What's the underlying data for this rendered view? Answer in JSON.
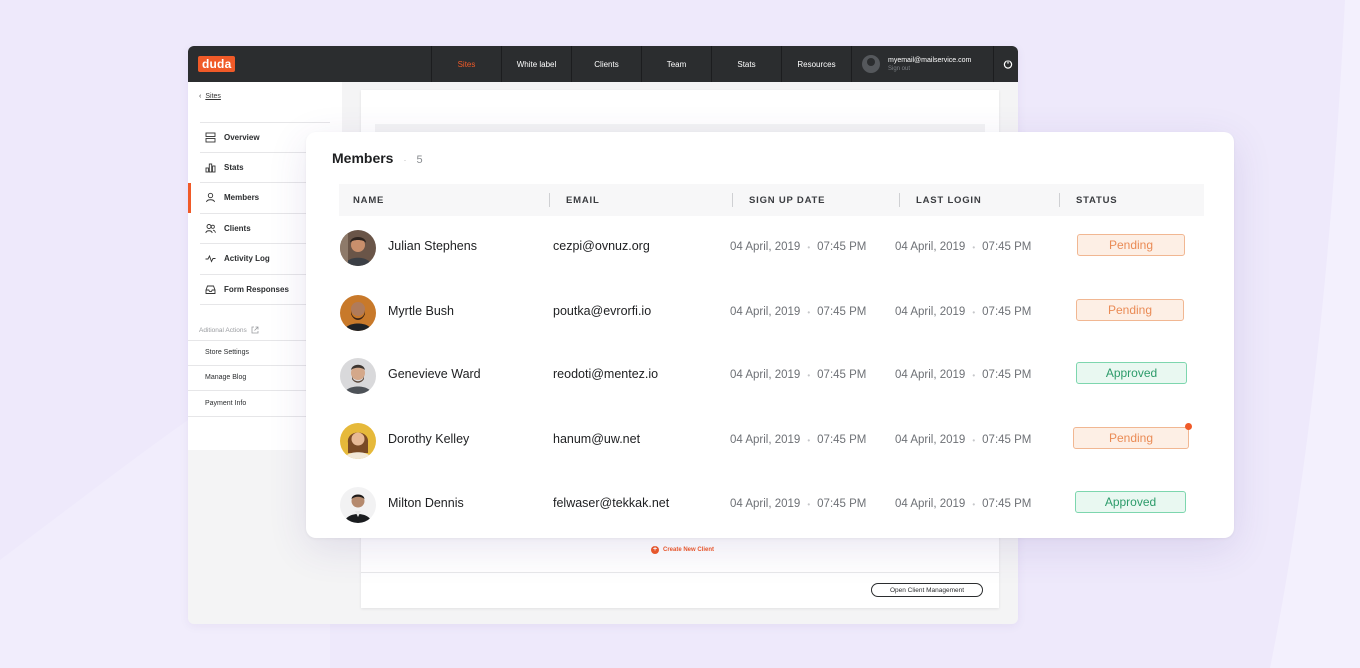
{
  "app": {
    "logo": "duda",
    "nav": [
      "Sites",
      "White label",
      "Clients",
      "Team",
      "Stats",
      "Resources"
    ],
    "active_nav": "Sites",
    "user": {
      "email": "myemail@mailservice.com",
      "signout": "Sign out"
    }
  },
  "sidebar": {
    "back_label": "Sites",
    "items": [
      {
        "label": "Overview",
        "icon": "overview-icon"
      },
      {
        "label": "Stats",
        "icon": "bar-chart-icon"
      },
      {
        "label": "Members",
        "icon": "user-icon",
        "active": true
      },
      {
        "label": "Clients",
        "icon": "users-icon"
      },
      {
        "label": "Activity Log",
        "icon": "activity-icon"
      },
      {
        "label": "Form Responses",
        "icon": "inbox-icon"
      }
    ],
    "section_label": "Aditional Actions",
    "sub_items": [
      "Store Settings",
      "Manage Blog",
      "Payment Info"
    ]
  },
  "content": {
    "create_label": "Create New Client",
    "open_button": "Open Client Management"
  },
  "members": {
    "title": "Members",
    "count": "5",
    "columns": [
      "NAME",
      "EMAIL",
      "SIGN UP DATE",
      "LAST LOGIN",
      "STATUS"
    ],
    "rows": [
      {
        "name": "Julian Stephens",
        "email": "cezpi@ovnuz.org",
        "signup_date": "04 April, 2019",
        "signup_time": "07:45 PM",
        "login_date": "04 April, 2019",
        "login_time": "07:45 PM",
        "status": "Pending"
      },
      {
        "name": "Myrtle Bush",
        "email": "poutka@evrorfi.io",
        "signup_date": "04 April, 2019",
        "signup_time": "07:45 PM",
        "login_date": "04 April, 2019",
        "login_time": "07:45 PM",
        "status": "Pending"
      },
      {
        "name": "Genevieve Ward",
        "email": "reodoti@mentez.io",
        "signup_date": "04 April, 2019",
        "signup_time": "07:45 PM",
        "login_date": "04 April, 2019",
        "login_time": "07:45 PM",
        "status": "Approved"
      },
      {
        "name": "Dorothy Kelley",
        "email": "hanum@uw.net",
        "signup_date": "04 April, 2019",
        "signup_time": "07:45 PM",
        "login_date": "04 April, 2019",
        "login_time": "07:45 PM",
        "status": "Pending"
      },
      {
        "name": "Milton Dennis",
        "email": "felwaser@tekkak.net",
        "signup_date": "04 April, 2019",
        "signup_time": "07:45 PM",
        "login_date": "04 April, 2019",
        "login_time": "07:45 PM",
        "status": "Approved"
      }
    ]
  },
  "colors": {
    "brand": "#f05a28",
    "topbar": "#2b2d2f",
    "pending_text": "#ea8b55",
    "approved_text": "#2c9b6a"
  }
}
